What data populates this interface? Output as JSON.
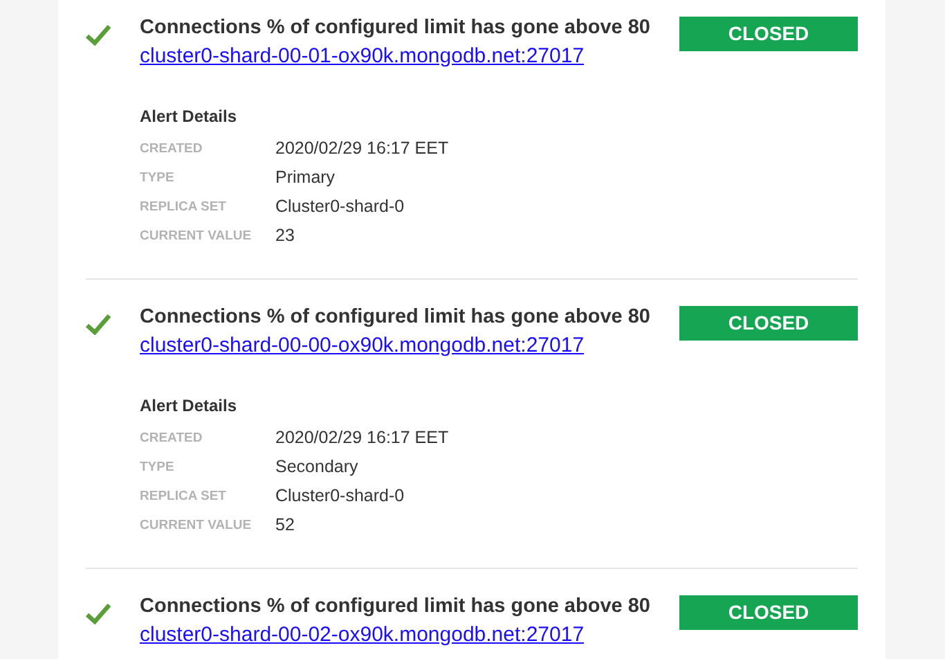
{
  "alerts": [
    {
      "closed": true,
      "title": "Connections % of configured limit has gone above 80",
      "host": "cluster0-shard-00-01-ox90k.mongodb.net:27017",
      "badge": "CLOSED",
      "details_heading": "Alert Details",
      "details": [
        {
          "label": "CREATED",
          "value": "2020/02/29 16:17 EET"
        },
        {
          "label": "TYPE",
          "value": "Primary"
        },
        {
          "label": "REPLICA SET",
          "value": "Cluster0-shard-0"
        },
        {
          "label": "CURRENT VALUE",
          "value": "23"
        }
      ]
    },
    {
      "closed": true,
      "title": "Connections % of configured limit has gone above 80",
      "host": "cluster0-shard-00-00-ox90k.mongodb.net:27017",
      "badge": "CLOSED",
      "details_heading": "Alert Details",
      "details": [
        {
          "label": "CREATED",
          "value": "2020/02/29 16:17 EET"
        },
        {
          "label": "TYPE",
          "value": "Secondary"
        },
        {
          "label": "REPLICA SET",
          "value": "Cluster0-shard-0"
        },
        {
          "label": "CURRENT VALUE",
          "value": "52"
        }
      ]
    },
    {
      "closed": true,
      "title": "Connections % of configured limit has gone above 80",
      "host": "cluster0-shard-00-02-ox90k.mongodb.net:27017",
      "badge": "CLOSED"
    }
  ]
}
